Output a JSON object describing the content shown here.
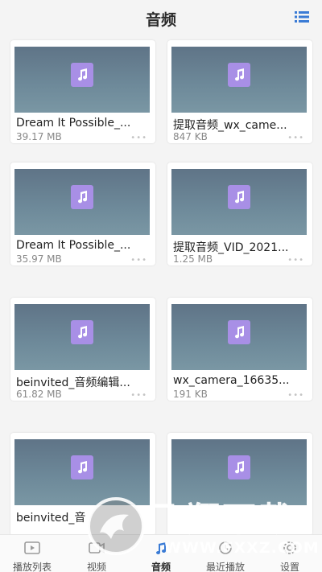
{
  "header": {
    "title": "音频",
    "menu_icon": "list-icon"
  },
  "items": [
    {
      "name": "Dream It Possible_...",
      "size": "39.17 MB",
      "more": "•••"
    },
    {
      "name": "提取音频_wx_came...",
      "size": "847 KB",
      "more": "•••"
    },
    {
      "name": "Dream It Possible_...",
      "size": "35.97 MB",
      "more": "•••"
    },
    {
      "name": "提取音频_VID_2021...",
      "size": "1.25 MB",
      "more": "•••"
    },
    {
      "name": "beinvited_音频编辑...",
      "size": "61.82 MB",
      "more": "•••"
    },
    {
      "name": "wx_camera_16635...",
      "size": "191 KB",
      "more": "•••"
    },
    {
      "name": "beinvited_音",
      "size": "",
      "more": ""
    },
    {
      "name": "",
      "size": "",
      "more": ""
    }
  ],
  "tabs": [
    {
      "label": "播放列表",
      "icon": "playlist-icon"
    },
    {
      "label": "视频",
      "icon": "video-icon"
    },
    {
      "label": "音频",
      "icon": "audio-icon",
      "active": true
    },
    {
      "label": "最近播放",
      "icon": "history-icon"
    },
    {
      "label": "设置",
      "icon": "settings-icon"
    }
  ],
  "watermark": {
    "text": "飞翔下载",
    "url": "WWW.FXXZ.COM"
  },
  "colors": {
    "note_tile": "#a88fe6",
    "thumb": "#6e8a9a",
    "accent": "#3a7bd5"
  }
}
